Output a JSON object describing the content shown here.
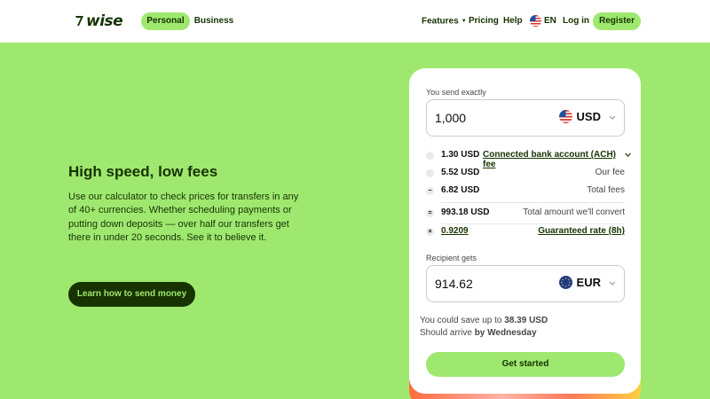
{
  "header": {
    "logo_text": "wise",
    "tabs": [
      {
        "label": "Personal"
      },
      {
        "label": "Business"
      }
    ],
    "nav": {
      "features": "Features",
      "pricing": "Pricing",
      "help": "Help",
      "language": "EN",
      "login": "Log in",
      "register": "Register"
    }
  },
  "hero": {
    "title": "High speed, low fees",
    "body": "Use our calculator to check prices for transfers in any of 40+ currencies. Whether scheduling payments or putting down deposits — over half our transfers get there in under 20 seconds. See it to believe it.",
    "cta": "Learn how to send money"
  },
  "calculator": {
    "send_label": "You send exactly",
    "send_amount": "1,000",
    "send_currency": "USD",
    "fees": [
      {
        "icon": "•",
        "amount": "1.30 USD",
        "label": "Connected bank account (ACH) fee"
      },
      {
        "icon": "•",
        "amount": "5.52 USD",
        "label": "Our fee"
      },
      {
        "icon": "−",
        "amount": "6.82 USD",
        "label": "Total fees"
      }
    ],
    "convert": {
      "icon": "=",
      "amount": "993.18 USD",
      "label": "Total amount we'll convert"
    },
    "rate": {
      "icon": "×",
      "amount": "0.9209",
      "label": "Guaranteed rate (8h)"
    },
    "receive_label": "Recipient gets",
    "receive_amount": "914.62",
    "receive_currency": "EUR",
    "save_prefix": "You could save up to",
    "save_amount": "38.39 USD",
    "arrive_prefix": "Should arrive",
    "arrive_value": "by Wednesday",
    "cta": "Get started"
  },
  "colors": {
    "brand_green": "#9fe870",
    "forest": "#163300",
    "white": "#ffffff"
  }
}
